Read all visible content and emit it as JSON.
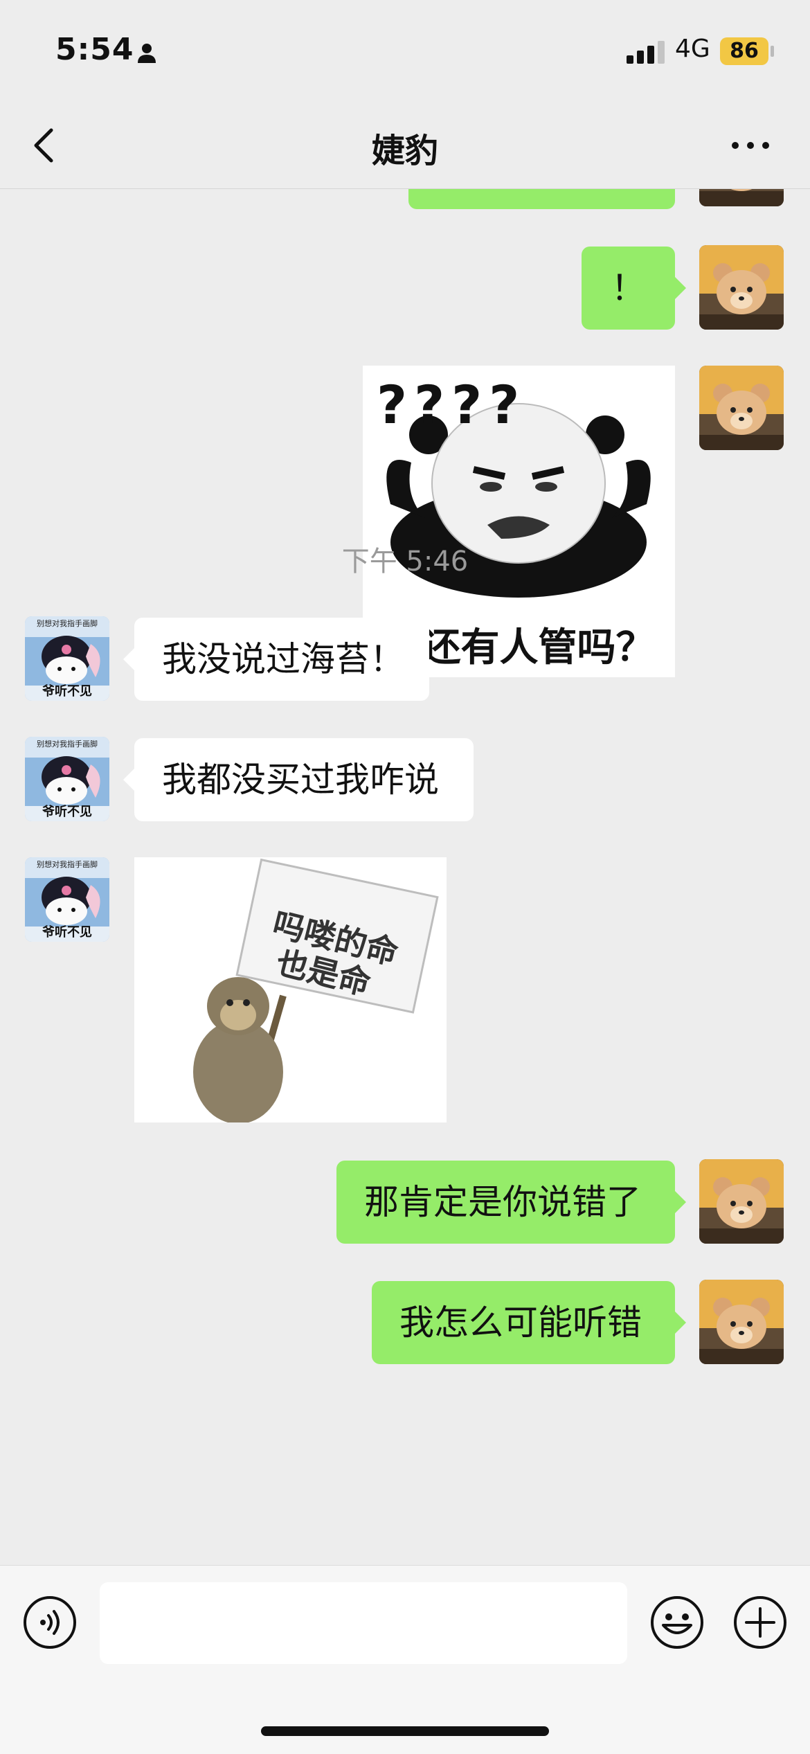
{
  "status_bar": {
    "time": "5:54",
    "network": "4G",
    "battery": "86"
  },
  "nav": {
    "title": "婕豹"
  },
  "messages": [
    {
      "text": "！"
    },
    {
      "text": "我没说过海苔！"
    },
    {
      "text": "我都没买过我咋说"
    },
    {
      "text": "那肯定是你说错了"
    },
    {
      "text": "我怎么可能听错"
    }
  ],
  "timestamp": "下午 5:46",
  "stickers": {
    "panda": {
      "question_marks": "????",
      "caption": "这还有人管吗？"
    },
    "monkey": {
      "sign_line1": "吗喽的命",
      "sign_line2": "也是命"
    }
  },
  "avatars": {
    "contact": {
      "top_text": "别想对我指手画脚",
      "bottom_text": "爷听不见"
    }
  },
  "input": {
    "placeholder": ""
  },
  "colors": {
    "my_bubble": "#95ec69",
    "their_bubble": "#ffffff",
    "background": "#ededed"
  }
}
